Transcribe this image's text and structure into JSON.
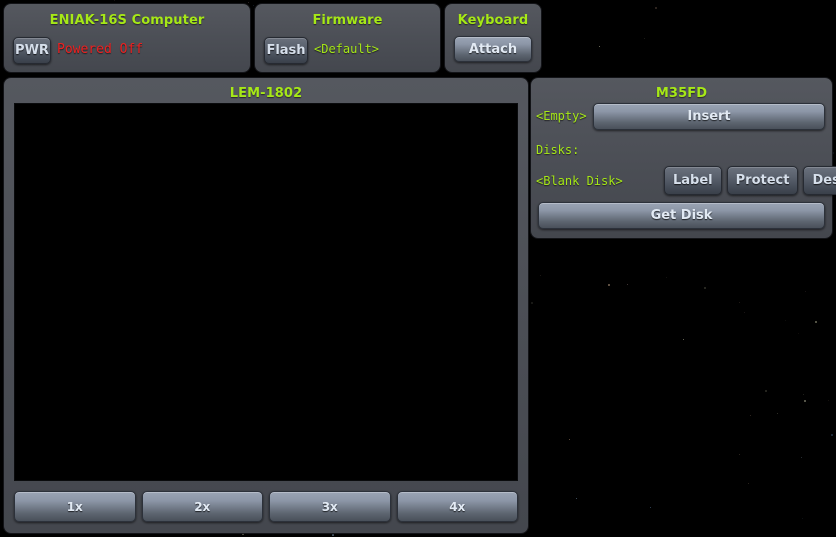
{
  "app": {
    "background_color": "#000000",
    "panel_color": "#4d5058",
    "title_color": "#a6e817",
    "status_error_color": "#ee2020",
    "button_text_color": "#d2dce8"
  },
  "computer_panel": {
    "title": "ENIAK-16S Computer",
    "power_button_label": "PWR",
    "power_status": "Powered Off"
  },
  "firmware_panel": {
    "title": "Firmware",
    "flash_button_label": "Flash",
    "firmware_value": "<Default>"
  },
  "keyboard_panel": {
    "title": "Keyboard",
    "attach_button_label": "Attach"
  },
  "monitor_panel": {
    "title": "LEM-1802",
    "screen_state": "",
    "scale_buttons": [
      {
        "label": "1x"
      },
      {
        "label": "2x"
      },
      {
        "label": "3x"
      },
      {
        "label": "4x"
      }
    ]
  },
  "m35fd_panel": {
    "title": "M35FD",
    "drive_state": "<Empty>",
    "insert_button_label": "Insert",
    "disks_label": "Disks:",
    "disk_name": "<Blank Disk>",
    "disk_actions": [
      {
        "label": "Label"
      },
      {
        "label": "Protect"
      },
      {
        "label": "Destroy"
      }
    ],
    "get_disk_button_label": "Get Disk"
  }
}
